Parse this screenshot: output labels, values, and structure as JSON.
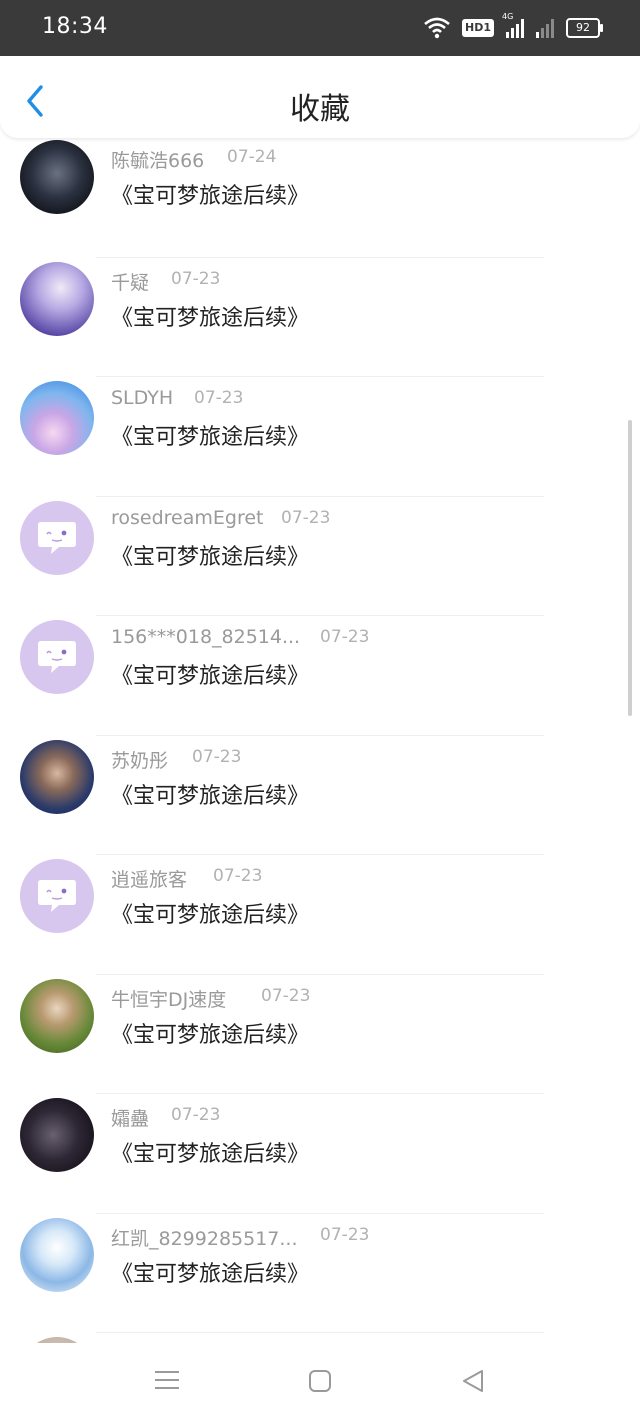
{
  "status_bar": {
    "time": "18:34",
    "network": "4G",
    "battery": "92",
    "hd_label": "HD1"
  },
  "header": {
    "title": "收藏",
    "back_icon": "chevron-left-icon"
  },
  "colors": {
    "accent": "#1f8ee6",
    "status_bar_bg": "#3a3a3a",
    "name_gray": "#9a9a9a",
    "bubble_avatar": "#d7c6ee"
  },
  "favorites": [
    {
      "name": "陈毓浩666",
      "date": "07-24",
      "text": "《宝可梦旅途后续》",
      "avatar": "photo-dark-dragon"
    },
    {
      "name": "千疑",
      "date": "07-23",
      "text": "《宝可梦旅途后续》",
      "avatar": "photo-anime-boy-purple"
    },
    {
      "name": "SLDYH",
      "date": "07-23",
      "text": "《宝可梦旅途后续》",
      "avatar": "photo-sky-blossom"
    },
    {
      "name": "rosedreamEgret",
      "date": "07-23",
      "text": "《宝可梦旅途后续》",
      "avatar": "default-chat-bubble"
    },
    {
      "name": "156***018_82514...",
      "date": "07-23",
      "text": "《宝可梦旅途后续》",
      "avatar": "default-chat-bubble"
    },
    {
      "name": "苏奶彤",
      "date": "07-23",
      "text": "《宝可梦旅途后续》",
      "avatar": "photo-person-sunglasses"
    },
    {
      "name": "逍遥旅客",
      "date": "07-23",
      "text": "《宝可梦旅途后续》",
      "avatar": "default-chat-bubble"
    },
    {
      "name": "牛恒宇DJ速度",
      "date": "07-23",
      "text": "《宝可梦旅途后续》",
      "avatar": "photo-kitten-cup"
    },
    {
      "name": "孀蠱",
      "date": "07-23",
      "text": "《宝可梦旅途后续》",
      "avatar": "photo-dark-crystal"
    },
    {
      "name": "红凯_8299285517...",
      "date": "07-23",
      "text": "《宝可梦旅途后续》",
      "avatar": "photo-anime-white-hair"
    }
  ],
  "nav_bar": {
    "menu_icon": "menu-icon",
    "home_icon": "home-square-icon",
    "back_icon": "triangle-back-icon"
  }
}
